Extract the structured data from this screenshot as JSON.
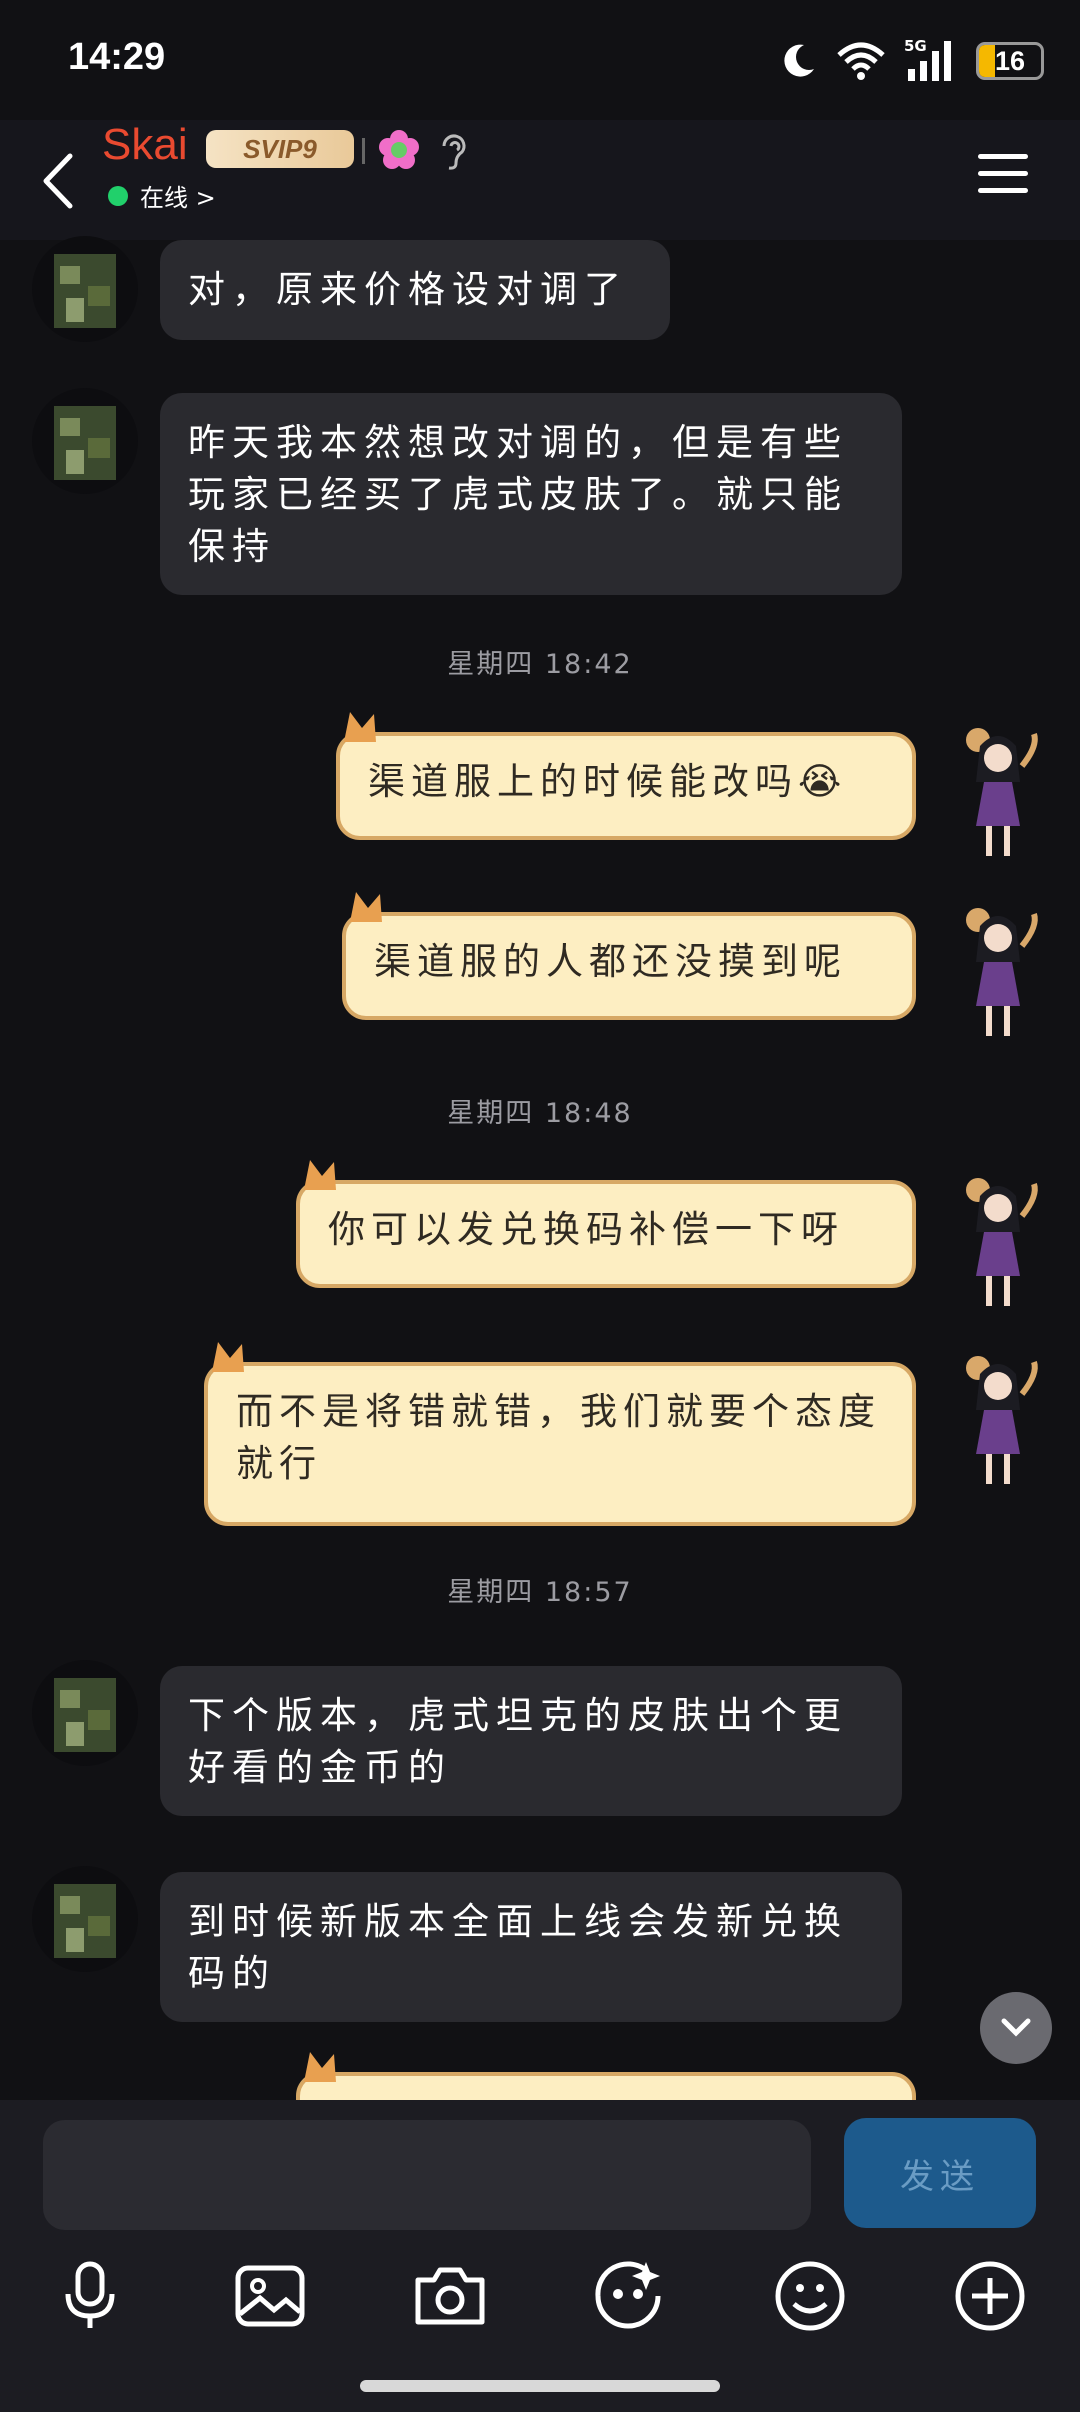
{
  "status_bar": {
    "time": "14:29",
    "network": "5G",
    "battery": "16"
  },
  "header": {
    "contact_name": "Skai",
    "vip": "SVIP9",
    "status": "在线",
    "status_arrow": ">"
  },
  "messages": [
    {
      "side": "in",
      "text": "对，原来价格设对调了"
    },
    {
      "side": "in",
      "text": "昨天我本然想改对调的，但是有些玩家已经买了虎式皮肤了。就只能保持"
    },
    {
      "type": "time",
      "text": "星期四 18:42"
    },
    {
      "side": "out",
      "text": "渠道服上的时候能改吗",
      "emoji": "😭"
    },
    {
      "side": "out",
      "text": "渠道服的人都还没摸到呢"
    },
    {
      "type": "time",
      "text": "星期四 18:48"
    },
    {
      "side": "out",
      "text": "你可以发兑换码补偿一下呀"
    },
    {
      "side": "out",
      "text": "而不是将错就错，我们就要个态度就行"
    },
    {
      "type": "time",
      "text": "星期四 18:57"
    },
    {
      "side": "in",
      "text": "下个版本，虎式坦克的皮肤出个更好看的金币的"
    },
    {
      "side": "in",
      "text": "到时候新版本全面上线会发新兑换码的"
    }
  ],
  "input": {
    "placeholder": "",
    "send_label": "发送"
  },
  "icons": [
    "back-arrow-icon",
    "menu-icon",
    "mic-icon",
    "image-icon",
    "camera-icon",
    "sticker-icon",
    "emoji-icon",
    "plus-icon"
  ],
  "colors": {
    "name": "#e94a30",
    "bubble_out": "#fdeec2",
    "bubble_in": "#2a2a2f",
    "send": "#1d5a8c"
  }
}
